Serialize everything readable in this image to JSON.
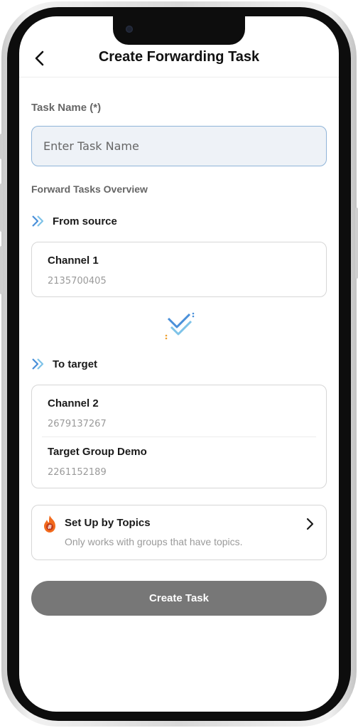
{
  "header": {
    "title": "Create Forwarding Task"
  },
  "form": {
    "task_name_label": "Task Name (*)",
    "task_name_placeholder": "Enter Task Name",
    "task_name_value": ""
  },
  "overview": {
    "heading": "Forward Tasks Overview",
    "source": {
      "label": "From source",
      "channels": [
        {
          "name": "Channel 1",
          "id": "2135700405"
        }
      ]
    },
    "target": {
      "label": "To target",
      "channels": [
        {
          "name": "Channel 2",
          "id": "2679137267"
        },
        {
          "name": "Target Group Demo",
          "id": "2261152189"
        }
      ]
    }
  },
  "topics": {
    "title": "Set Up by Topics",
    "subtitle": "Only works with groups that have topics."
  },
  "actions": {
    "create_label": "Create Task"
  },
  "colors": {
    "accent_blue": "#4a90d9",
    "create_button": "#777777",
    "input_background": "#eef2f7",
    "fire_orange": "#f26b1d"
  },
  "icons": {
    "back": "back-arrow-icon",
    "source": "double-chevron-right-icon",
    "swap": "forward-swap-icon",
    "topics": "fire-icon",
    "more": "chevron-right-icon"
  }
}
